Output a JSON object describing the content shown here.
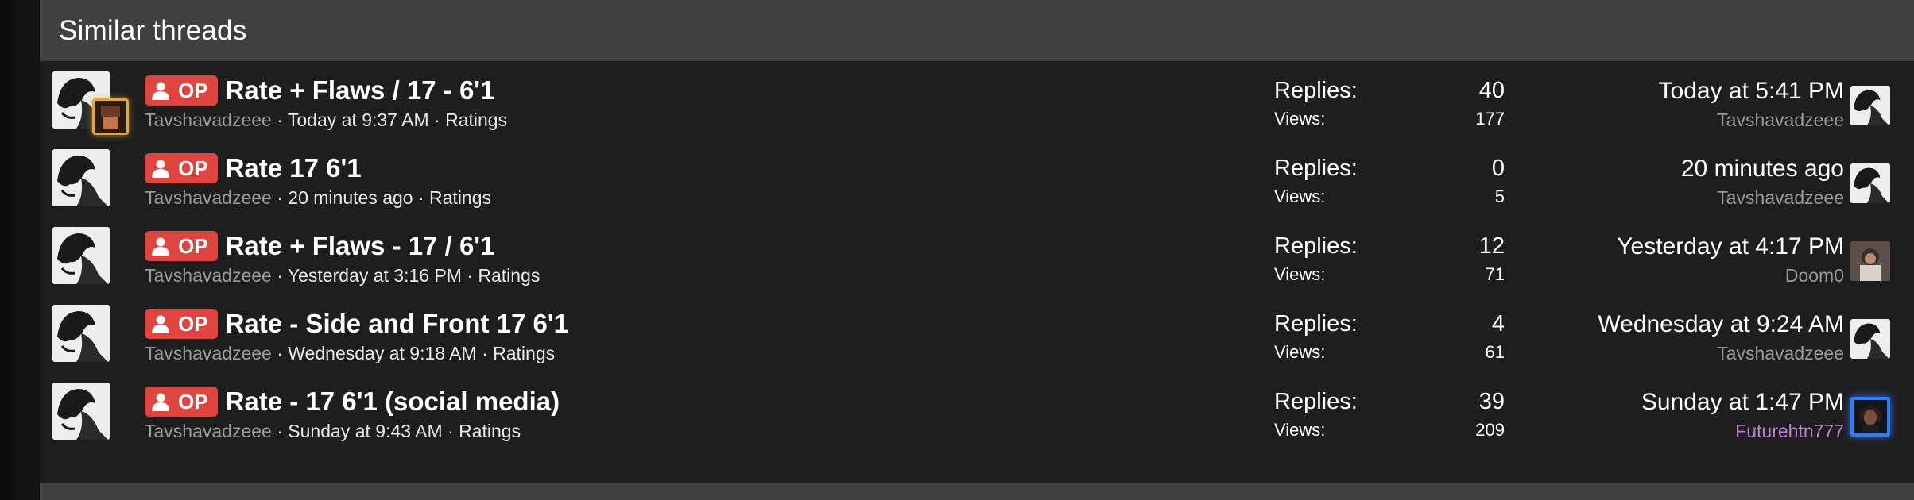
{
  "block": {
    "title": "Similar threads"
  },
  "labels": {
    "op": "OP",
    "replies": "Replies:",
    "views": "Views:",
    "sep": " · "
  },
  "colors": {
    "op_badge": "#e0443f",
    "header_bg": "#404040",
    "body_bg": "#1e1e1e",
    "muted_user": "#9a9a9a",
    "highlight_user": "#c27fd6",
    "mini_avatar_border": "#e8a62c",
    "blue_avatar_border": "#2f7bff"
  },
  "threads": [
    {
      "title": "Rate + Flaws / 17 - 6'1",
      "starter": "Tavshavadzeee",
      "started": "Today at 9:37 AM",
      "forum": "Ratings",
      "replies": "40",
      "views": "177",
      "last_date": "Today at 5:41 PM",
      "last_user": "Tavshavadzeee"
    },
    {
      "title": "Rate 17 6'1",
      "starter": "Tavshavadzeee",
      "started": "20 minutes ago",
      "forum": "Ratings",
      "replies": "0",
      "views": "5",
      "last_date": "20 minutes ago",
      "last_user": "Tavshavadzeee"
    },
    {
      "title": "Rate + Flaws - 17 / 6'1",
      "starter": "Tavshavadzeee",
      "started": "Yesterday at 3:16 PM",
      "forum": "Ratings",
      "replies": "12",
      "views": "71",
      "last_date": "Yesterday at 4:17 PM",
      "last_user": "Doom0"
    },
    {
      "title": "Rate - Side and Front 17 6'1",
      "starter": "Tavshavadzeee",
      "started": "Wednesday at 9:18 AM",
      "forum": "Ratings",
      "replies": "4",
      "views": "61",
      "last_date": "Wednesday at 9:24 AM",
      "last_user": "Tavshavadzeee"
    },
    {
      "title": "Rate - 17 6'1 (social media)",
      "starter": "Tavshavadzeee",
      "started": "Sunday at 9:43 AM",
      "forum": "Ratings",
      "replies": "39",
      "views": "209",
      "last_date": "Sunday at 1:47 PM",
      "last_user": "Futurehtn777"
    }
  ]
}
